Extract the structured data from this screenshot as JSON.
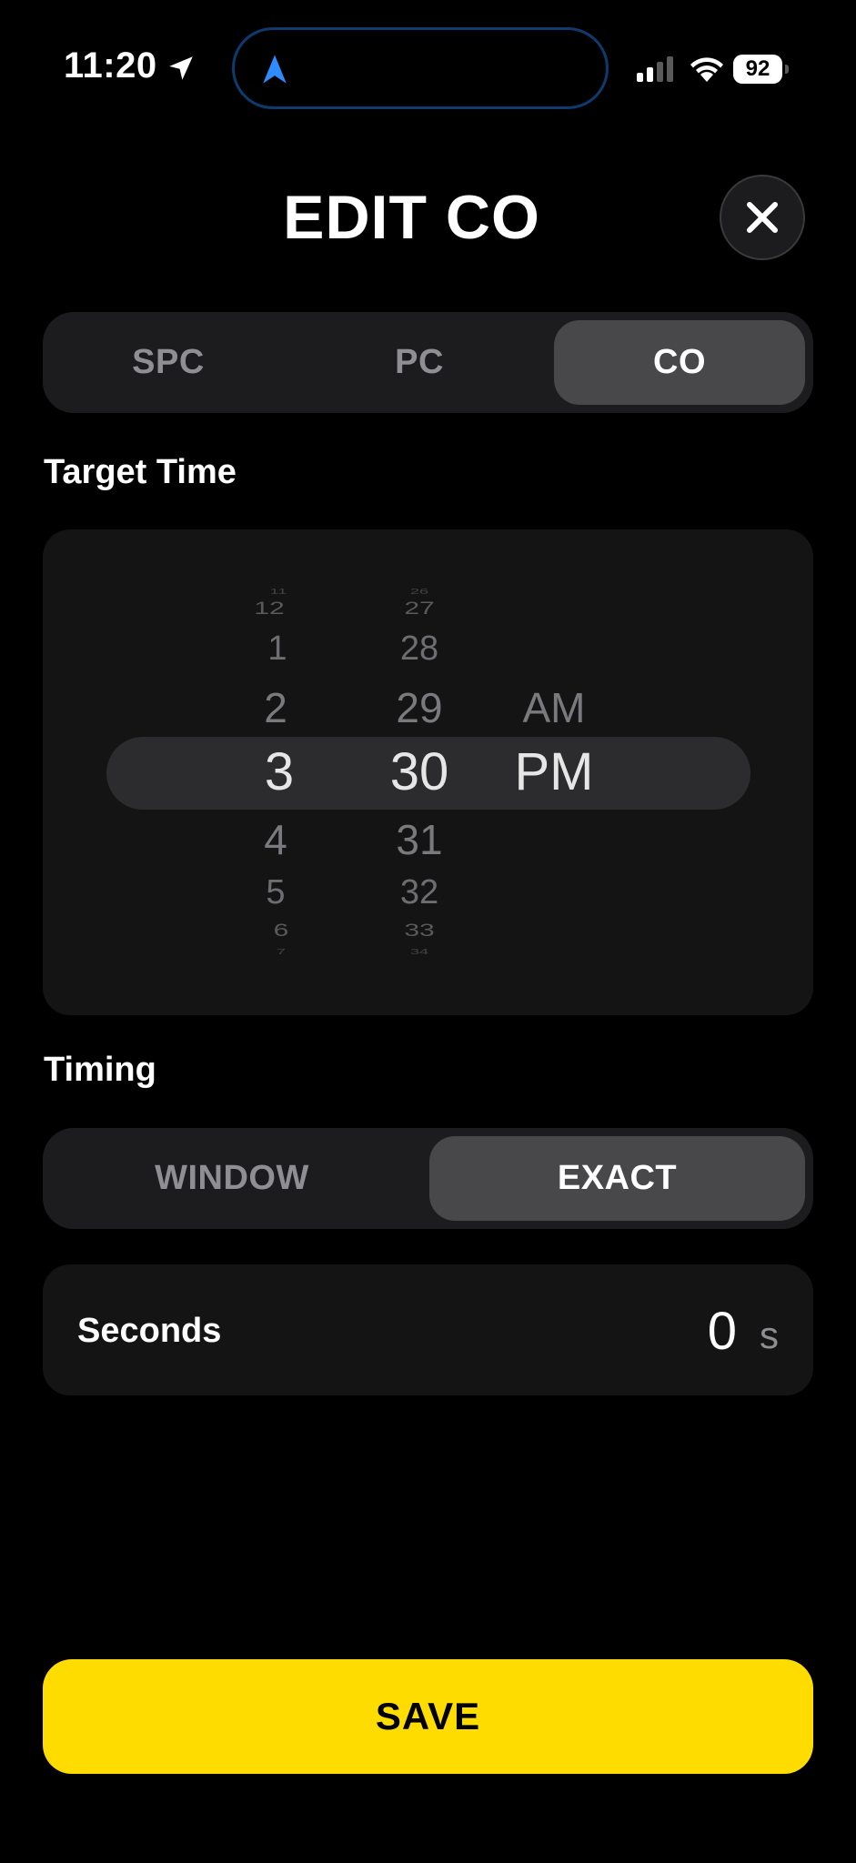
{
  "status_bar": {
    "time": "11:20",
    "battery": "92"
  },
  "header": {
    "title": "EDIT CO"
  },
  "category_tabs": [
    {
      "label": "SPC",
      "active": false
    },
    {
      "label": "PC",
      "active": false
    },
    {
      "label": "CO",
      "active": true
    }
  ],
  "target_time": {
    "label": "Target Time",
    "hour": {
      "above": [
        "11",
        "12",
        "1",
        "2"
      ],
      "selected": "3",
      "below": [
        "4",
        "5",
        "6",
        "7"
      ]
    },
    "minute": {
      "above": [
        "26",
        "27",
        "28",
        "29"
      ],
      "selected": "30",
      "below": [
        "31",
        "32",
        "33",
        "34"
      ]
    },
    "period": {
      "above": [
        "AM"
      ],
      "selected": "PM"
    }
  },
  "timing": {
    "label": "Timing",
    "tabs": [
      {
        "label": "WINDOW",
        "active": false
      },
      {
        "label": "EXACT",
        "active": true
      }
    ]
  },
  "seconds": {
    "label": "Seconds",
    "value": "0",
    "unit": "s"
  },
  "save_label": "SAVE",
  "colors": {
    "accent": "#ffdc00",
    "background": "#000000",
    "card": "#141414",
    "active_segment": "#48484a",
    "location_blue": "#2f8cff"
  }
}
